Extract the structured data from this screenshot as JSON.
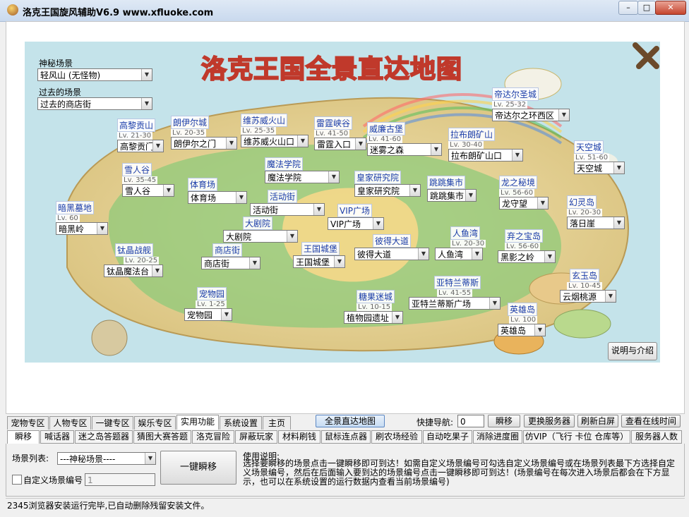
{
  "window": {
    "title": "洛克王国旋风辅助V6.9 www.xfluoke.com",
    "btn_min": "–",
    "btn_max": "□",
    "btn_close": "✕"
  },
  "map": {
    "title": "洛克王国全景直达地图",
    "mystery": {
      "label": "神秘场景",
      "value": "轻风山 (无怪物)"
    },
    "past": {
      "label": "过去的场景",
      "value": "过去的商店街"
    },
    "help_button": "说明与介绍",
    "locations": [
      {
        "name": "高黎贡山",
        "lv": "Lv. 21-30",
        "value": "高黎贡门廊"
      },
      {
        "name": "朗伊尔城",
        "lv": "Lv. 20-35",
        "value": "朗伊尔之门"
      },
      {
        "name": "维苏威火山",
        "lv": "Lv. 25-35",
        "value": "维苏威火山口"
      },
      {
        "name": "雷霆峡谷",
        "lv": "Lv. 41-50",
        "value": "雷霆入口"
      },
      {
        "name": "威廉古堡",
        "lv": "Lv. 41-60",
        "value": "迷雾之森"
      },
      {
        "name": "拉布朗矿山",
        "lv": "Lv. 30-40",
        "value": "拉布朗矿山口"
      },
      {
        "name": "帝达尔圣城",
        "lv": "Lv. 25-32",
        "value": "帝达尔之环西区"
      },
      {
        "name": "天空城",
        "lv": "Lv. 51-60",
        "value": "天空城"
      },
      {
        "name": "雪人谷",
        "lv": "Lv. 35-45",
        "value": "雪人谷"
      },
      {
        "name": "体育场",
        "lv": "",
        "value": "体育场"
      },
      {
        "name": "魔法学院",
        "lv": "",
        "value": "魔法学院"
      },
      {
        "name": "皇家研究院",
        "lv": "",
        "value": "皇家研究院"
      },
      {
        "name": "跳跳集市",
        "lv": "",
        "value": "跳跳集市"
      },
      {
        "name": "龙之秘境",
        "lv": "Lv. 56-60",
        "value": "龙守望"
      },
      {
        "name": "幻灵岛",
        "lv": "Lv. 20-30",
        "value": "落日崖"
      },
      {
        "name": "暗黑墓地",
        "lv": "Lv. 60",
        "value": "暗黑岭"
      },
      {
        "name": "活动街",
        "lv": "",
        "value": "活动街"
      },
      {
        "name": "VIP广场",
        "lv": "",
        "value": "VIP广场"
      },
      {
        "name": "大剧院",
        "lv": "",
        "value": "大剧院"
      },
      {
        "name": "彼得大道",
        "lv": "",
        "value": "彼得大道"
      },
      {
        "name": "人鱼湾",
        "lv": "Lv. 20-30",
        "value": "人鱼湾"
      },
      {
        "name": "弃之宝岛",
        "lv": "Lv. 56-60",
        "value": "黑影之岭"
      },
      {
        "name": "钛晶战舰",
        "lv": "Lv. 20-25",
        "value": "钛晶魔法台"
      },
      {
        "name": "商店街",
        "lv": "",
        "value": "商店街"
      },
      {
        "name": "王国城堡",
        "lv": "",
        "value": "王国城堡"
      },
      {
        "name": "玄玉岛",
        "lv": "Lv. 10-45",
        "value": "云烟桃源"
      },
      {
        "name": "宠物园",
        "lv": "Lv. 1-25",
        "value": "宠物园"
      },
      {
        "name": "糖果迷城",
        "lv": "Lv. 10-15",
        "value": "植物园遗址"
      },
      {
        "name": "亚特兰蒂斯",
        "lv": "Lv. 41-55",
        "value": "亚特兰蒂斯广场"
      },
      {
        "name": "英雄岛",
        "lv": "Lv. 100",
        "value": "英雄岛"
      }
    ]
  },
  "tabs": [
    "宠物专区",
    "人物专区",
    "一键专区",
    "娱乐专区",
    "实用功能",
    "系统设置",
    "主页"
  ],
  "toolbar": {
    "map_button": "全景直达地图",
    "nav_label": "快捷导航:",
    "nav_value": "0",
    "teleport": "瞬移",
    "switch_server": "更换服务器",
    "refresh": "刷新白屏",
    "online_time": "查看在线时间"
  },
  "subtabs": [
    "瞬移",
    "喊话器",
    "迷之岛答题器",
    "猜图大赛答题",
    "洛克冒险",
    "屏蔽玩家",
    "材料刷钱",
    "鼠标连点器",
    "刷农场经验",
    "自动吃果子",
    "消除进度圈",
    "仿VIP（飞行 卡位 仓库等）",
    "服务器人数"
  ],
  "panel": {
    "scene_list_label": "场景列表:",
    "scene_list_value": "---神秘场景----",
    "custom_label": "自定义场景编号",
    "custom_value": "1",
    "one_key_button": "一键瞬移",
    "usage_title": "使用说明:",
    "usage_text": "选择要瞬移的场景点击一键瞬移即可到达！如需自定义场景编号可勾选自定义场景编号或在场景列表最下方选择自定义场景编号，然后在后面输入要到达的场景编号点击一键瞬移即可到达！(场景编号在每次进入场景后都会在下方显示，也可以在系统设置的运行数据内查看当前场景编号)"
  },
  "status": "2345浏览器安装运行完毕,已自动删除残留安装文件。",
  "colors": {
    "map_water": "#c4e3ea",
    "land": "#e9d9a6",
    "location_name": "#1a3ca8",
    "title_fill": "#ffe14d",
    "title_stroke": "#c0392b"
  }
}
